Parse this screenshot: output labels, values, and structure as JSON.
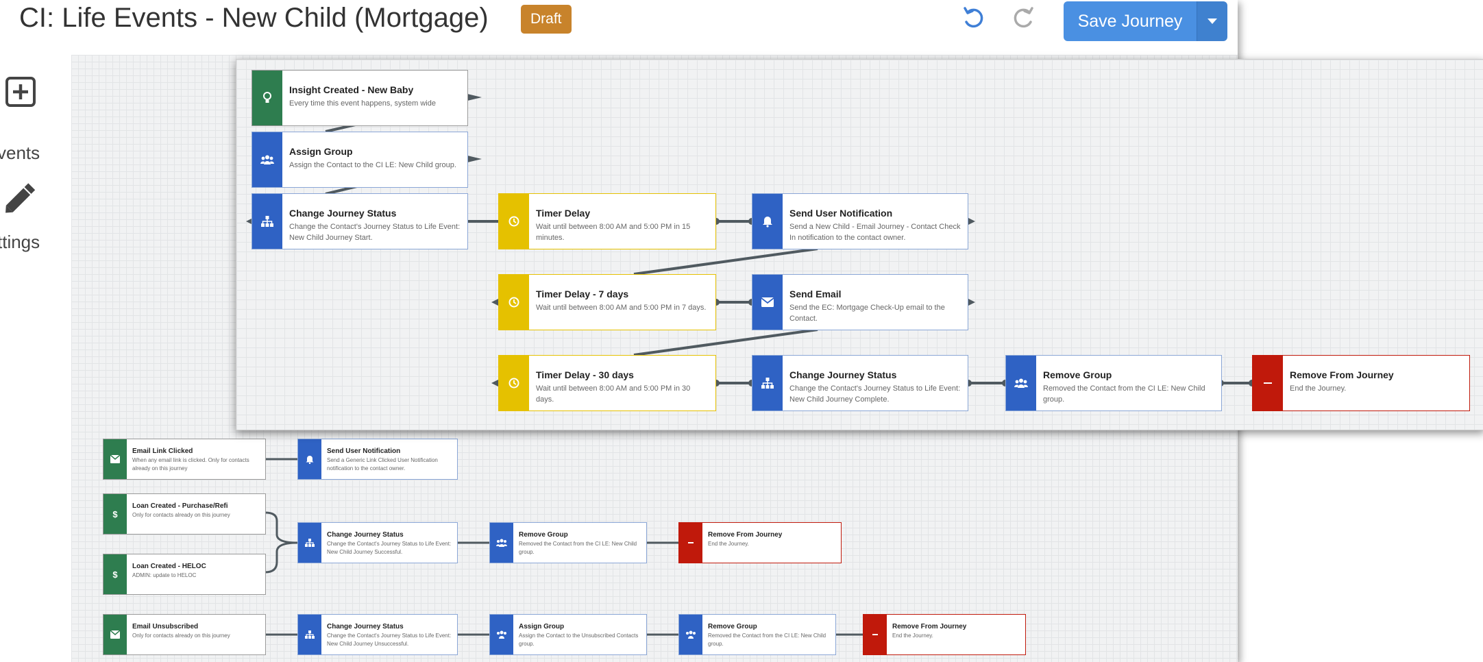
{
  "header": {
    "title": "CI: Life Events - New Child (Mortgage)",
    "status": "Draft",
    "save_label": "Save Journey"
  },
  "sidebar": {
    "items": [
      {
        "label": "vents",
        "icon": "plus-square-icon"
      },
      {
        "label": "ttings",
        "icon": "pencil-icon"
      }
    ]
  },
  "colors": {
    "trigger": "#2e7d4f",
    "action": "#2f62c4",
    "timer": "#e5c100",
    "exit": "#c0190b",
    "primary": "#4a90e2",
    "draft": "#c8832b"
  },
  "overlay": {
    "nodes": [
      {
        "title": "Insight Created - New Baby",
        "desc": "Every time this event happens, system wide"
      },
      {
        "title": "Assign Group",
        "desc": "Assign the Contact to the CI LE: New Child group."
      },
      {
        "title": "Change Journey Status",
        "desc": "Change the Contact's Journey Status to Life Event: New Child Journey Start."
      },
      {
        "title": "Timer Delay",
        "desc": "Wait until between 8:00 AM and 5:00 PM in 15 minutes."
      },
      {
        "title": "Send User Notification",
        "desc": "Send a New Child - Email Journey - Contact Check In notification to the contact owner."
      },
      {
        "title": "Timer Delay - 7 days",
        "desc": "Wait until between 8:00 AM and 5:00 PM in 7 days."
      },
      {
        "title": "Send Email",
        "desc": "Send the EC: Mortgage Check-Up email to the Contact."
      },
      {
        "title": "Timer Delay - 30 days",
        "desc": "Wait until between 8:00 AM and 5:00 PM in 30 days."
      },
      {
        "title": "Change Journey Status",
        "desc": "Change the Contact's Journey Status to Life Event: New Child Journey Complete."
      },
      {
        "title": "Remove Group",
        "desc": "Removed the Contact from the CI LE: New Child group."
      },
      {
        "title": "Remove From Journey",
        "desc": "End the Journey."
      }
    ]
  },
  "canvas": {
    "nodes": [
      {
        "title": "Email Link Clicked",
        "desc": "When any email link is clicked. Only for contacts already on this journey"
      },
      {
        "title": "Send User Notification",
        "desc": "Send a Generic Link Clicked User Notification notification to the contact owner."
      },
      {
        "title": "Loan Created - Purchase/Refi",
        "desc": "Only for contacts already on this journey"
      },
      {
        "title": "Change Journey Status",
        "desc": "Change the Contact's Journey Status to Life Event: New Child Journey Successful."
      },
      {
        "title": "Remove Group",
        "desc": "Removed the Contact from the CI LE: New Child group."
      },
      {
        "title": "Remove From Journey",
        "desc": "End the Journey."
      },
      {
        "title": "Loan Created - HELOC",
        "desc": "ADMIN: update to HELOC"
      },
      {
        "title": "Email Unsubscribed",
        "desc": "Only for contacts already on this journey"
      },
      {
        "title": "Change Journey Status",
        "desc": "Change the Contact's Journey Status to Life Event: New Child Journey Unsuccessful."
      },
      {
        "title": "Assign Group",
        "desc": "Assign the Contact to the Unsubscribed Contacts group."
      },
      {
        "title": "Remove Group",
        "desc": "Removed the Contact from the CI LE: New Child group."
      },
      {
        "title": "Remove From Journey",
        "desc": "End the Journey."
      }
    ]
  }
}
